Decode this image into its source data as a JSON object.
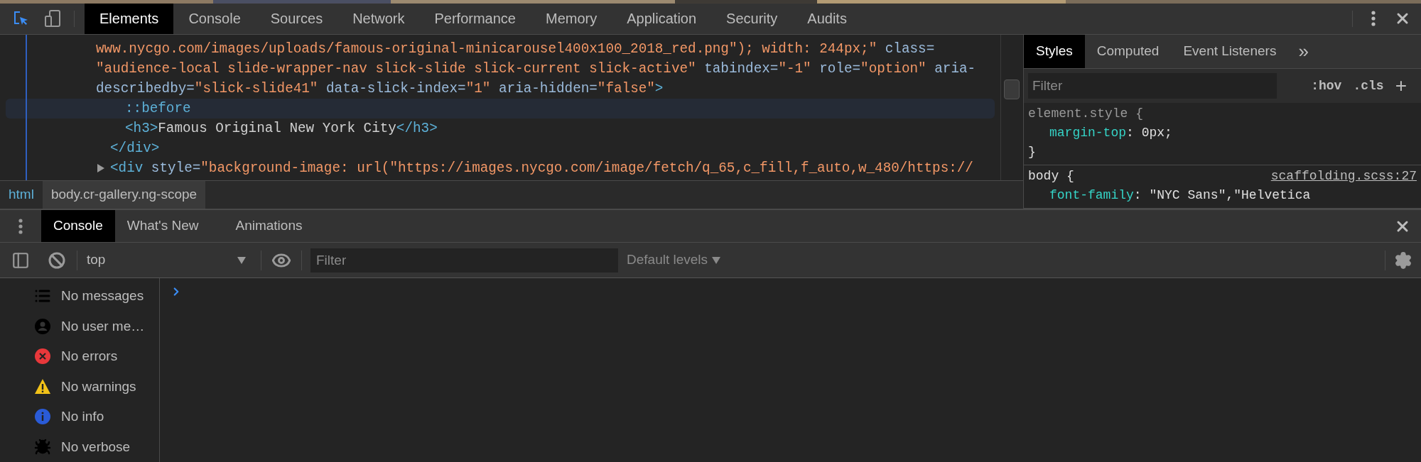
{
  "top_toolbar": {
    "tabs": [
      {
        "label": "Elements",
        "selected": true
      },
      {
        "label": "Console",
        "selected": false
      },
      {
        "label": "Sources",
        "selected": false
      },
      {
        "label": "Network",
        "selected": false
      },
      {
        "label": "Performance",
        "selected": false
      },
      {
        "label": "Memory",
        "selected": false
      },
      {
        "label": "Application",
        "selected": false
      },
      {
        "label": "Security",
        "selected": false
      },
      {
        "label": "Audits",
        "selected": false
      }
    ]
  },
  "elements_panel": {
    "dom_tree": [
      {
        "kind": "continued",
        "selected": false,
        "lines": [
          [
            {
              "kind": "value",
              "t": "www.nycgo.com/images/uploads/famous-original-minicarousel400x100_2018_red.png\"); width: 244px;\""
            },
            {
              "kind": "attr",
              "t": " class="
            }
          ],
          [
            {
              "kind": "value",
              "t": "\"audience-local slide-wrapper-nav slick-slide slick-current slick-active\""
            },
            {
              "kind": "attr",
              "t": " tabindex="
            },
            {
              "kind": "value",
              "t": "\"-1\""
            },
            {
              "kind": "attr",
              "t": " role="
            },
            {
              "kind": "value",
              "t": "\"option\""
            },
            {
              "kind": "attr",
              "t": " aria-"
            }
          ],
          [
            {
              "kind": "attr",
              "t": "describedby="
            },
            {
              "kind": "value",
              "t": "\"slick-slide41\""
            },
            {
              "kind": "attr",
              "t": " data-slick-index="
            },
            {
              "kind": "value",
              "t": "\"1\""
            },
            {
              "kind": "attr",
              "t": " aria-hidden="
            },
            {
              "kind": "value",
              "t": "\"false\""
            },
            {
              "kind": "tag",
              "t": ">"
            }
          ]
        ],
        "children": [
          {
            "selected": true,
            "tokens": [
              {
                "kind": "pseudo",
                "t": "::before"
              }
            ]
          },
          {
            "selected": false,
            "tokens": [
              {
                "kind": "tag",
                "t": "<h3>"
              },
              {
                "kind": "text",
                "t": "Famous Original New York City"
              },
              {
                "kind": "tag",
                "t": "</h3>"
              }
            ]
          }
        ],
        "closing": [
          {
            "kind": "tag",
            "t": "</div>"
          }
        ]
      },
      {
        "kind": "collapsed",
        "selected": false,
        "lines": [
          [
            {
              "kind": "tag",
              "t": "<div"
            },
            {
              "kind": "attr",
              "t": " style="
            },
            {
              "kind": "value",
              "t": "\"background-image: url(\"https://images.nycgo.com/image/fetch/q_65,c_fill,f_auto,w_480/https://"
            }
          ]
        ]
      }
    ],
    "breadcrumbs": [
      {
        "label": "html",
        "selected": false
      },
      {
        "label": "body.cr-gallery.ng-scope",
        "selected": true
      }
    ]
  },
  "styles_panel": {
    "tabs": [
      {
        "label": "Styles",
        "selected": true
      },
      {
        "label": "Computed",
        "selected": false
      },
      {
        "label": "Event Listeners",
        "selected": false
      }
    ],
    "more": "»",
    "filter": {
      "placeholder": "Filter"
    },
    "hov": ":hov",
    "cls": ".cls",
    "add": "+",
    "rules": [
      {
        "selector": "element.style",
        "open": " {",
        "declarations": [
          {
            "property": "margin-top",
            "rest": ": 0px;"
          }
        ],
        "close": "}"
      },
      {
        "selector": "body",
        "open": " {",
        "source": "scaffolding.scss:27",
        "declarations": [
          {
            "property": "font-family",
            "rest": ": \"NYC Sans\",\"Helvetica"
          }
        ]
      }
    ]
  },
  "drawer": {
    "tabs": [
      {
        "label": "Console",
        "selected": true
      },
      {
        "label": "What's New",
        "selected": false
      },
      {
        "label": "Animations",
        "selected": false
      }
    ],
    "context": {
      "value": "top"
    },
    "filter": {
      "placeholder": "Filter"
    },
    "levels": "Default levels",
    "sidebar": [
      {
        "kind": "messages",
        "label": "No messages",
        "selected": false
      },
      {
        "kind": "user",
        "label": "No user me…",
        "selected": false
      },
      {
        "kind": "errors",
        "label": "No errors",
        "selected": false
      },
      {
        "kind": "warnings",
        "label": "No warnings",
        "selected": false
      },
      {
        "kind": "info",
        "label": "No info",
        "selected": false
      },
      {
        "kind": "verbose",
        "label": "No verbose",
        "selected": false
      }
    ]
  }
}
